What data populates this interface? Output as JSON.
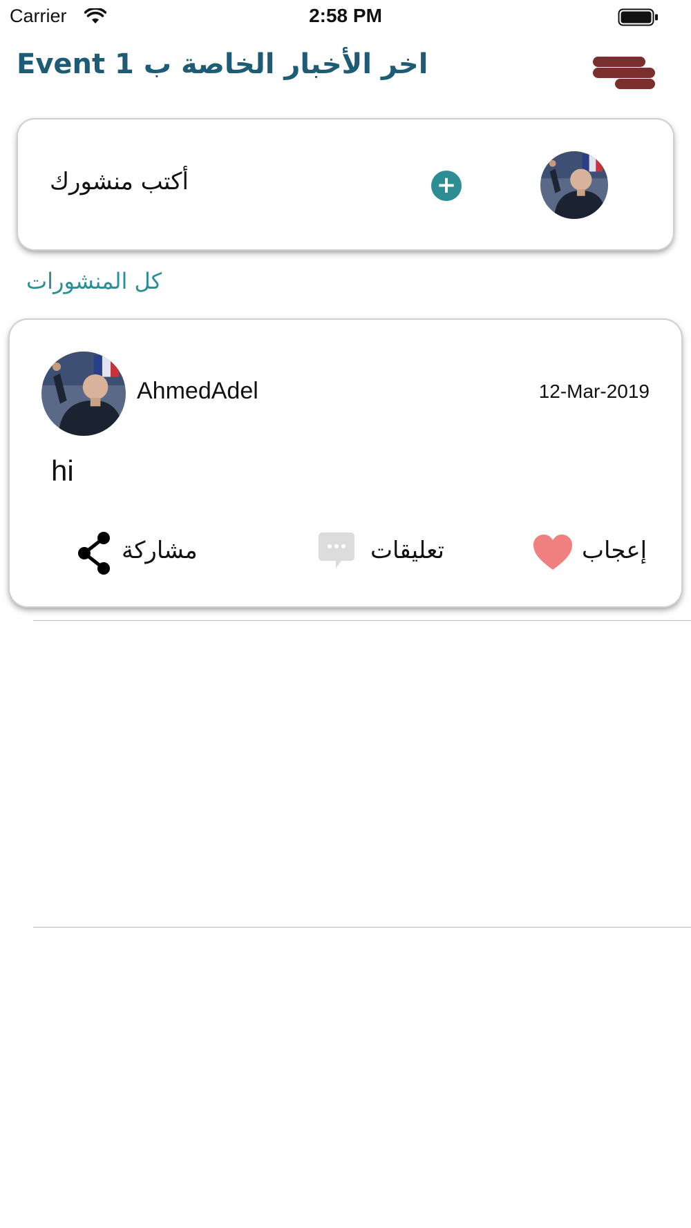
{
  "status_bar": {
    "carrier": "Carrier",
    "time": "2:58 PM"
  },
  "header": {
    "title": "اخر الأخبار الخاصة ب Event 1",
    "menu_icon": "menu-icon",
    "title_color": "#1d5c74",
    "menu_color": "#7b2e2e"
  },
  "composer": {
    "placeholder": "أكتب منشورك",
    "add_icon": "plus-icon",
    "accent_color": "#2c8e93"
  },
  "section": {
    "label": "كل المنشورات"
  },
  "post": {
    "author": "AhmedAdel",
    "date": "12-Mar-2019",
    "body": "hi",
    "actions": {
      "like": "إعجاب",
      "comments": "تعليقات",
      "share": "مشاركة"
    },
    "like_color": "#f08080"
  }
}
